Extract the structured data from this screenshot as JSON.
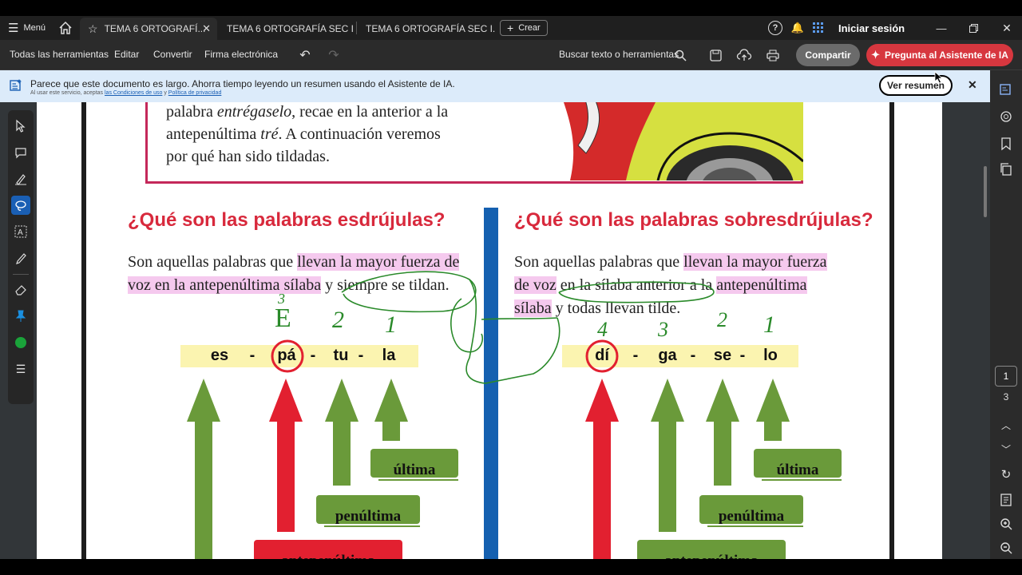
{
  "tabbar": {
    "menu_label": "Menú",
    "tabs": [
      {
        "label": "TEMA 6 ORTOGRAFÍ..."
      },
      {
        "label": "TEMA 6 ORTOGRAFÍA SEC I..."
      },
      {
        "label": "TEMA 6 ORTOGRAFÍA SEC I..."
      }
    ],
    "create_label": "Crear",
    "sign_in": "Iniciar sesión"
  },
  "toolbar": {
    "items": [
      "Todas las herramientas",
      "Editar",
      "Convertir",
      "Firma electrónica"
    ],
    "search_label": "Buscar texto o herramientas",
    "share_label": "Compartir",
    "ai_label": "Pregunta al Asistente de IA"
  },
  "banner": {
    "message": "Parece que este documento es largo. Ahorra tiempo leyendo un resumen usando el Asistente de IA.",
    "sub_prefix": "Al usar este servicio, aceptas",
    "terms_link": "las Condiciones de uso",
    "sub_and": "y",
    "privacy_link": "Política de privacidad",
    "button": "Ver resumen"
  },
  "pagenav": {
    "current": "1",
    "total": "3"
  },
  "document": {
    "intro": {
      "line1_a": "palabra ",
      "line1_em": "entrégaselo",
      "line1_b": ", recae en la anterior a la",
      "line2_a": "antepenúltima ",
      "line2_em": "tré",
      "line2_b": ". A continuación veremos",
      "line3": "por qué han sido tildadas."
    },
    "left": {
      "heading": "¿Qué son las palabras esdrújulas?",
      "def_a": "Son aquellas palabras que ",
      "def_hl1": "llevan la mayor fuerza de",
      "def_hl2": "voz en la antepenúltima sílaba",
      "def_b": " y siempre se tildan.",
      "syllables": [
        "es",
        "-",
        "pá",
        "-",
        "tu",
        "-",
        "la"
      ],
      "labels": {
        "last": "última",
        "penult": "penúltima",
        "antepenult": "antepenúltima"
      },
      "handwriting": {
        "three": "3",
        "e": "E",
        "two": "2",
        "one": "1"
      }
    },
    "right": {
      "heading": "¿Qué son las palabras sobresdrújulas?",
      "def_a": "Son aquellas palabras que ",
      "def_hl1": "llevan la mayor fuerza",
      "def_hl2": "de voz",
      "def_b": " en la sílaba anterior a la ",
      "def_hl3": "antepenúltima",
      "def_hl4": "sílaba",
      "def_c": " y todas llevan tilde.",
      "syllables": [
        "dí",
        "-",
        "ga",
        "-",
        "se",
        "-",
        "lo"
      ],
      "labels": {
        "last": "última",
        "penult": "penúltima",
        "antepenult": "antepenúltima"
      },
      "handwriting": {
        "four": "4",
        "three": "3",
        "two": "2",
        "one": "1"
      }
    }
  },
  "colors": {
    "heading": "#d8293c",
    "highlight": "#f5c9ee",
    "arrow_green": "#6a9a3a",
    "arrow_red": "#e22030",
    "divider": "#1560b0",
    "ink": "#2a8a2a"
  }
}
